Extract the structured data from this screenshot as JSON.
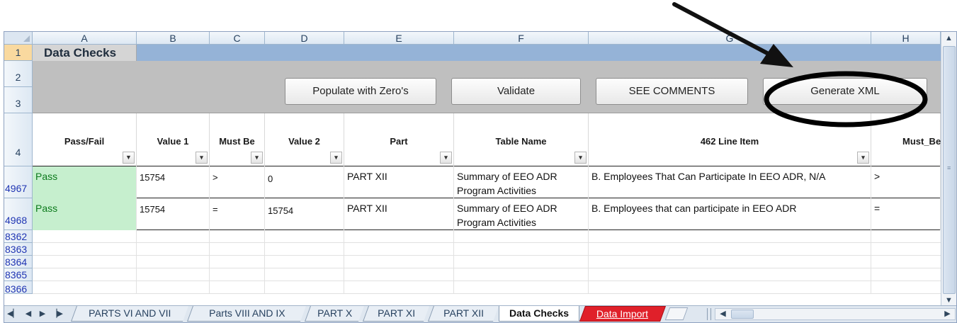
{
  "columns": [
    "A",
    "B",
    "C",
    "D",
    "E",
    "F",
    "G",
    "H"
  ],
  "title_row": {
    "row_num": "1",
    "text": "Data Checks"
  },
  "button_rows": [
    "2",
    "3"
  ],
  "buttons": {
    "populate": "Populate with Zero's",
    "validate": "Validate",
    "comments": "SEE COMMENTS",
    "generate": "Generate XML"
  },
  "header_row": {
    "row_num": "4",
    "cols": [
      "Pass/Fail",
      "Value 1",
      "Must Be",
      "Value 2",
      "Part",
      "Table Name",
      "462 Line Item",
      "Must_Be"
    ]
  },
  "rows": [
    {
      "row_num": "4967",
      "pass_fail": "Pass",
      "value1": "15754",
      "must_be": ">",
      "value2": "0",
      "part": "PART XII",
      "table_name": "Summary of EEO ADR Program Activities",
      "line_item": "B. Employees That Can Participate In EEO ADR, N/A",
      "must_be2": ">"
    },
    {
      "row_num": "4968",
      "pass_fail": "Pass",
      "value1": "15754",
      "must_be": "=",
      "value2": "15754",
      "part": "PART XII",
      "table_name": "Summary of EEO ADR Program Activities",
      "line_item": "B. Employees that can participate in EEO ADR",
      "must_be2": "="
    }
  ],
  "empty_rows": [
    "8362",
    "8363",
    "8364",
    "8365",
    "8366"
  ],
  "sheet_tabs": {
    "t1": "PARTS VI AND VII",
    "t2": "Parts VIII AND IX",
    "t3": "PART X",
    "t4": "PART XI",
    "t5": "PART XII",
    "active": "Data Checks",
    "red": "Data Import"
  },
  "colors": {
    "pass_fill": "#c6efce",
    "title_bar": "#95b3d7",
    "red_tab": "#e0202a"
  }
}
